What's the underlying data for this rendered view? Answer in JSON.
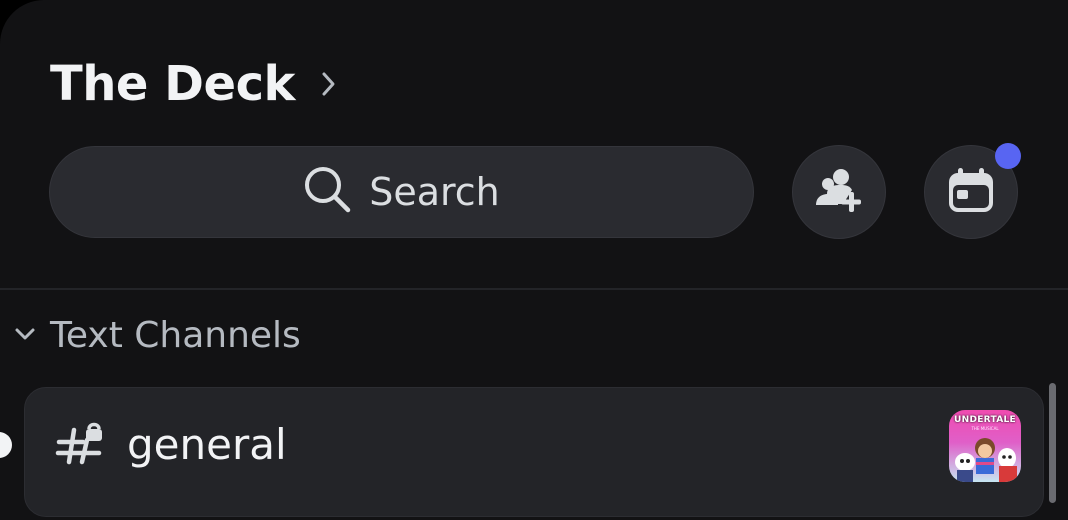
{
  "server": {
    "name": "The Deck"
  },
  "search": {
    "label": "Search"
  },
  "actions": {
    "invite_icon": "add-member-icon",
    "events_icon": "calendar-icon",
    "events_has_notification": true
  },
  "categories": [
    {
      "label": "Text Channels",
      "expanded": true,
      "channels": [
        {
          "name": "general",
          "icon": "locked-hashtag-icon",
          "unread": true,
          "activity": {
            "title": "UNDERTALE",
            "subtitle": "THE MUSICAL",
            "icon": "activity-thumbnail"
          }
        }
      ]
    }
  ],
  "colors": {
    "background": "#121214",
    "surface": "#2a2b30",
    "text_primary": "#f2f3f5",
    "text_muted": "#b5bac1",
    "accent": "#5865f2"
  }
}
